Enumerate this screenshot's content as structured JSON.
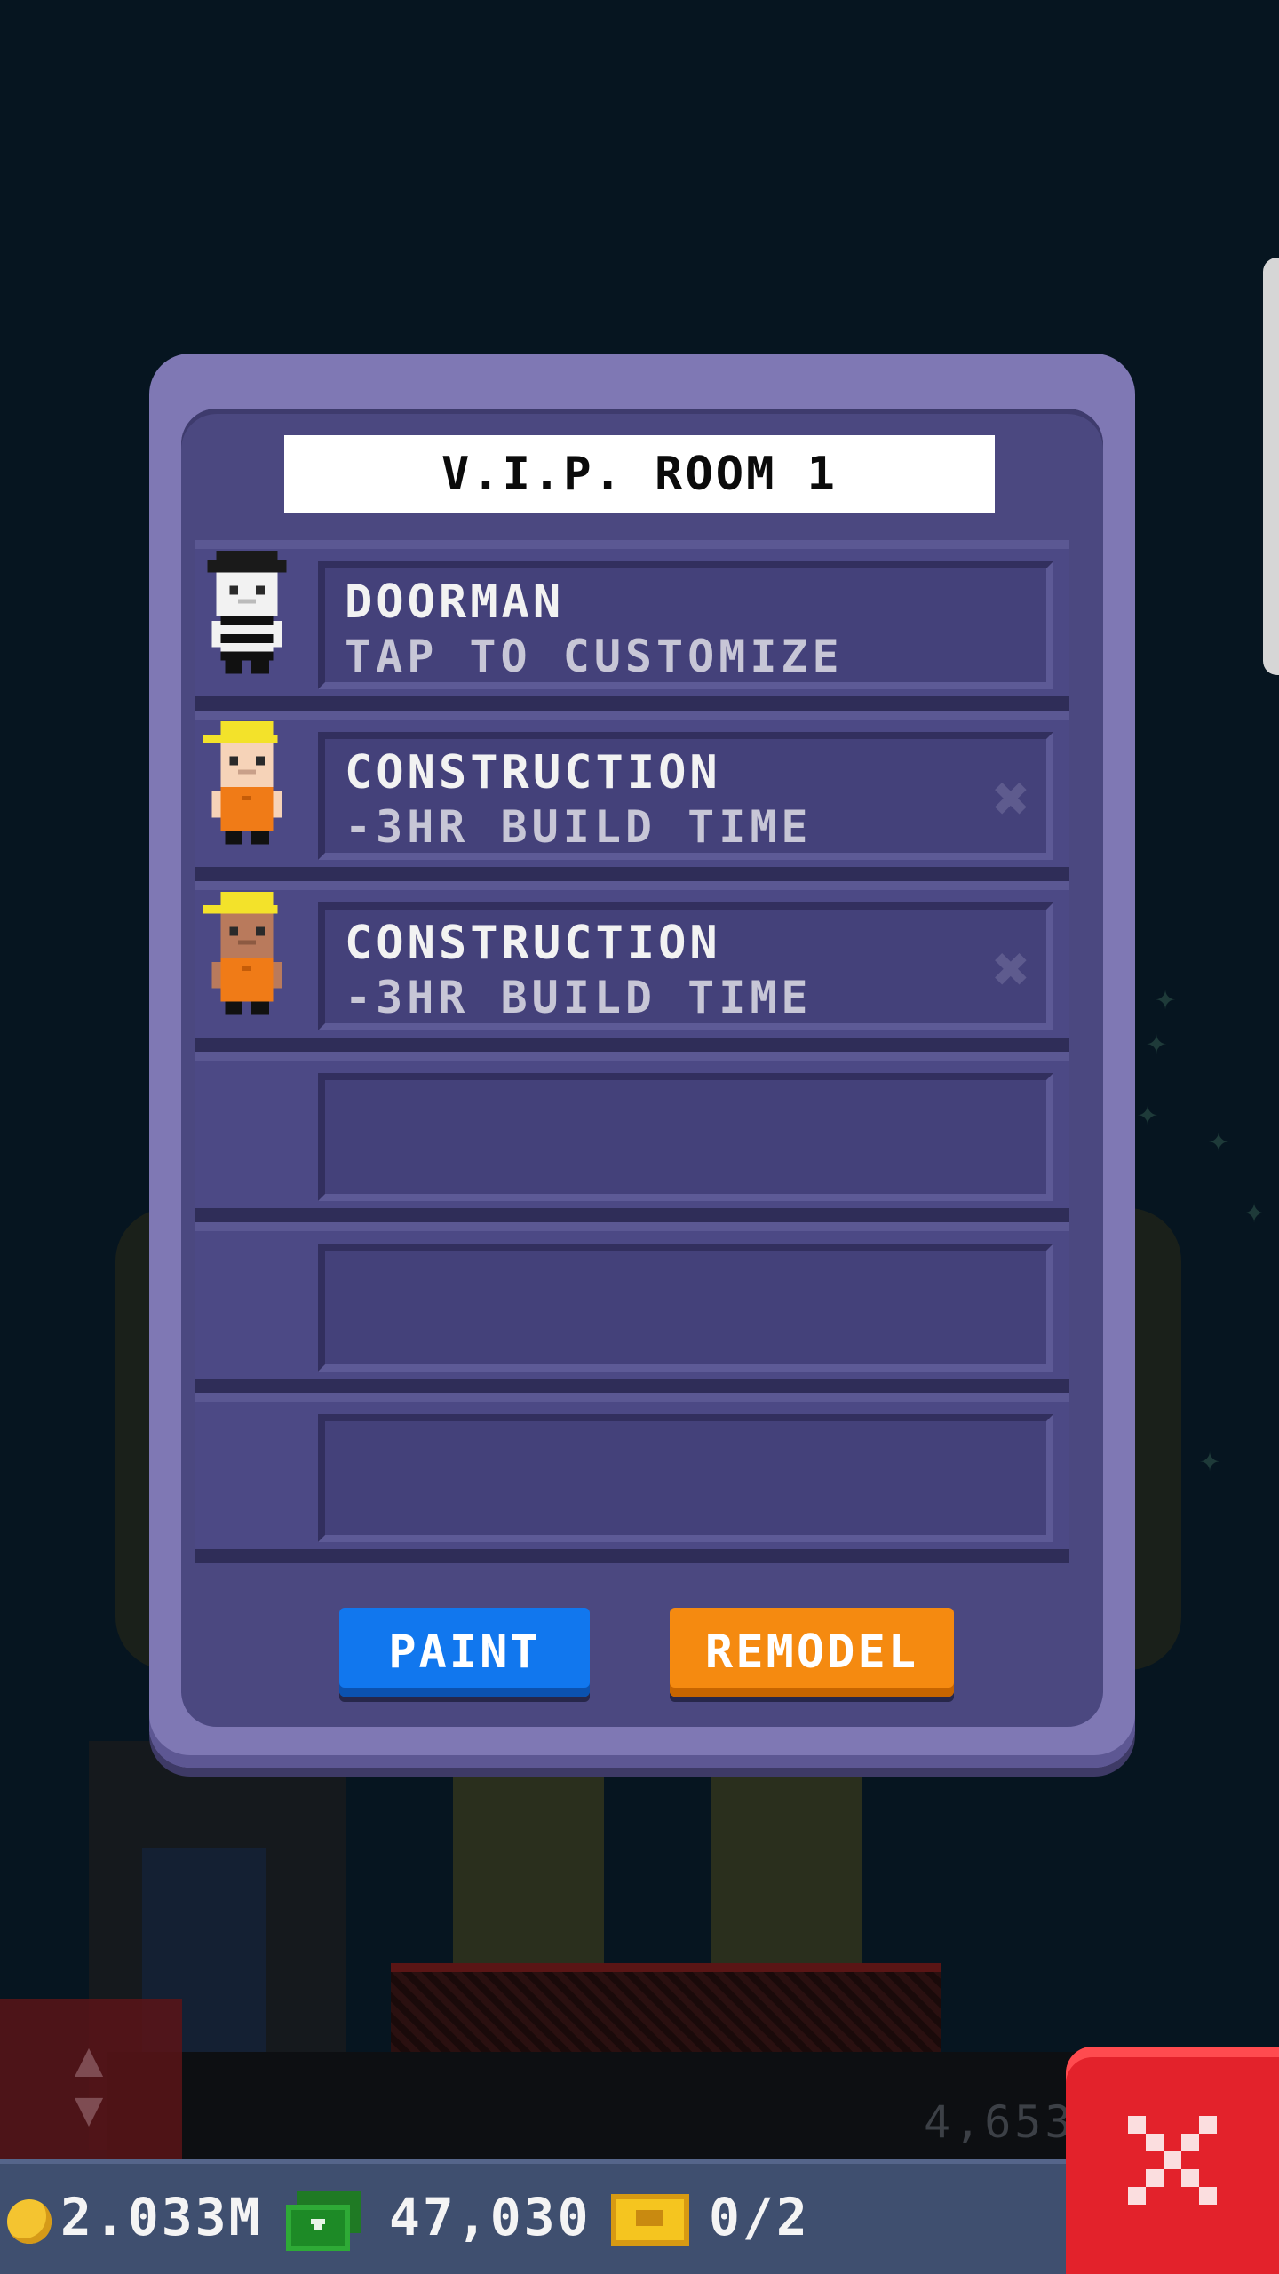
{
  "dialog": {
    "title": "V.I.P. ROOM 1",
    "rows": [
      {
        "title": "DOORMAN",
        "subtitle": "TAP TO CUSTOMIZE",
        "avatar": "doorman-icon",
        "removable": false
      },
      {
        "title": "CONSTRUCTION",
        "subtitle": "-3HR BUILD TIME",
        "avatar": "construction-worker-icon",
        "removable": true
      },
      {
        "title": "CONSTRUCTION",
        "subtitle": "-3HR BUILD TIME",
        "avatar": "construction-worker-icon",
        "removable": true
      },
      {
        "title": "",
        "subtitle": ""
      },
      {
        "title": "",
        "subtitle": ""
      },
      {
        "title": "",
        "subtitle": ""
      }
    ],
    "remove_glyph": "✖",
    "buttons": {
      "paint": "PAINT",
      "remodel": "REMODEL"
    }
  },
  "status_bar": {
    "coins": "2.033M",
    "bux": "47,030",
    "tickets": "0/2"
  },
  "background": {
    "counter": "4,653",
    "elevator_arrows": "▲\n▼"
  },
  "colors": {
    "paint_button": "#1177ee",
    "remodel_button": "#f58a10",
    "close_button": "#e3222b",
    "dialog_frame": "#7f78b4"
  },
  "icons": [
    "coin-icon",
    "cash-icon",
    "ticket-icon",
    "close-icon",
    "remove-icon"
  ]
}
